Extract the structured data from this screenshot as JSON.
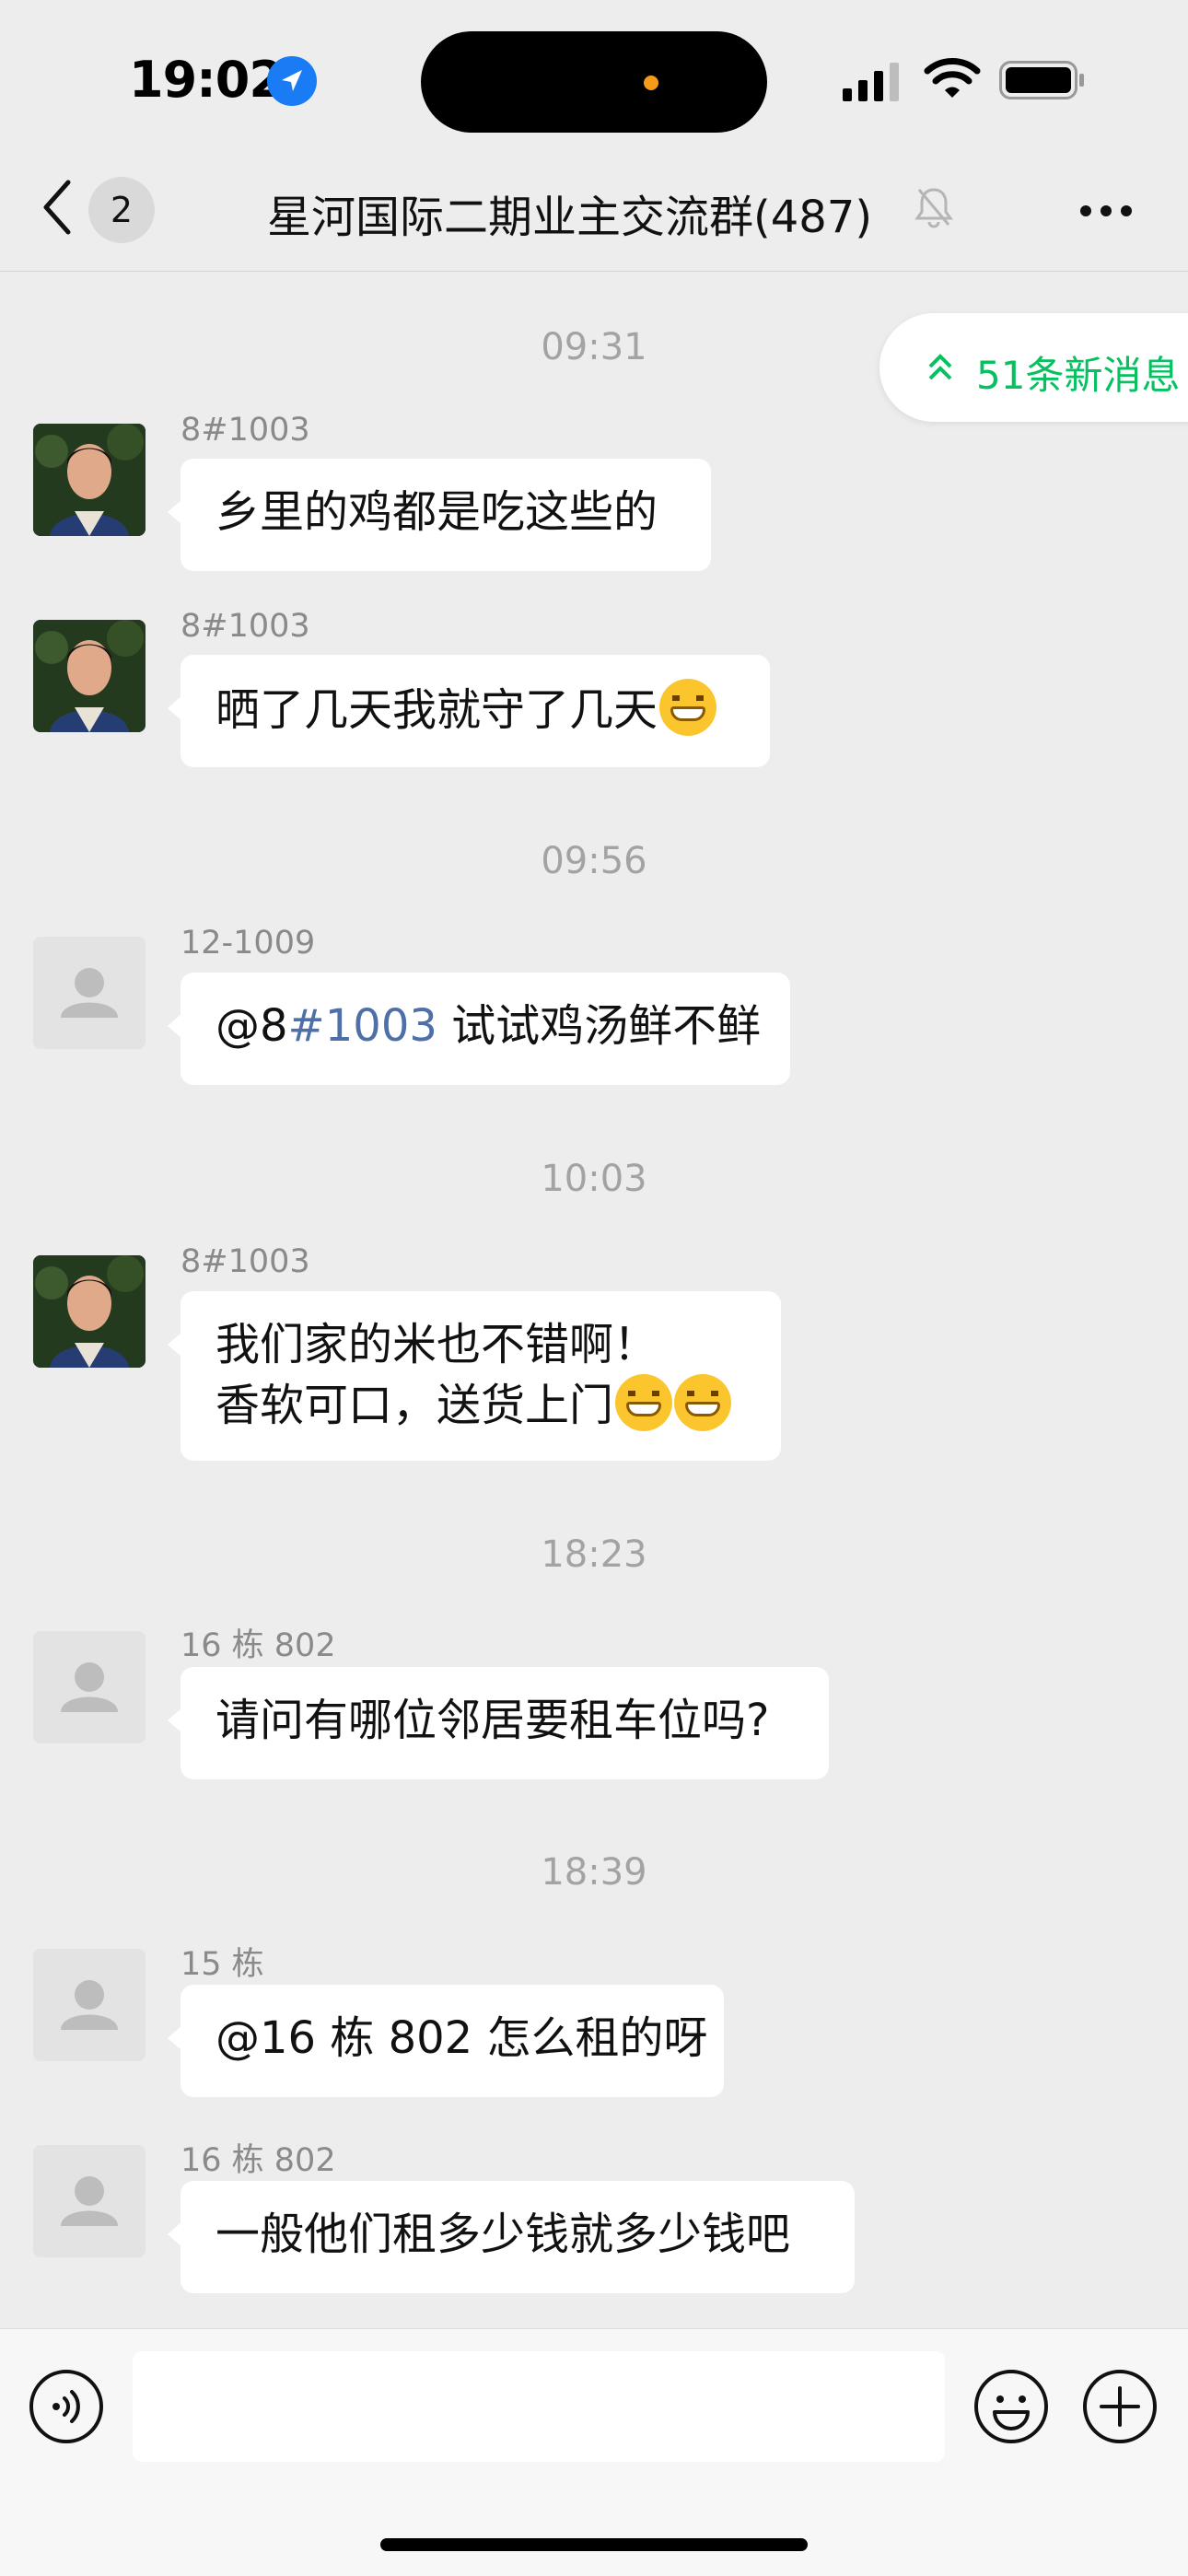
{
  "status_bar": {
    "time": "19:02"
  },
  "nav": {
    "unread_count": "2",
    "title": "星河国际二期业主交流群(487)"
  },
  "new_messages": {
    "label": "51条新消息"
  },
  "timestamps": [
    "09:31",
    "09:56",
    "10:03",
    "18:23",
    "18:39"
  ],
  "messages": [
    {
      "sender": "8#1003",
      "text": "乡里的鸡都是吃这些的"
    },
    {
      "sender": "8#1003",
      "text": "晒了几天我就守了几天"
    },
    {
      "sender": "12-1009",
      "mention_prefix": "@8",
      "mention_link": "#1003",
      "text": " 试试鸡汤鲜不鲜"
    },
    {
      "sender": "8#1003",
      "line1": "我们家的米也不错啊！",
      "line2": "香软可口，送货上门"
    },
    {
      "sender": "16 栋 802",
      "text": "请问有哪位邻居要租车位吗?"
    },
    {
      "sender": "15 栋",
      "text": "@16 栋 802 怎么租的呀"
    },
    {
      "sender": "16 栋 802",
      "text": "一般他们租多少钱就多少钱吧"
    }
  ],
  "input": {
    "value": "",
    "placeholder": ""
  }
}
